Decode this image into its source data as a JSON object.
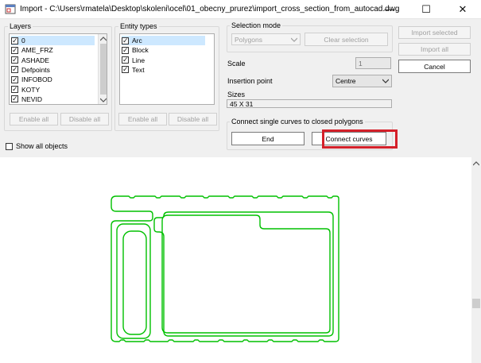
{
  "window": {
    "title": "Import - C:\\Users\\rmatela\\Desktop\\skoleni\\ocel\\01_obecny_prurez\\import_cross_section_from_autocad.dwg",
    "minimize_glyph": "—",
    "maximize_glyph": "☐",
    "close_glyph": "✕"
  },
  "layers": {
    "label": "Layers",
    "items": [
      "0",
      "AME_FRZ",
      "ASHADE",
      "Defpoints",
      "INFOBOD",
      "KOTY",
      "NEVID"
    ],
    "selected_index": 0,
    "enable_all": "Enable all",
    "disable_all": "Disable all"
  },
  "entity_types": {
    "label": "Entity types",
    "items": [
      "Arc",
      "Block",
      "Line",
      "Text"
    ],
    "selected_index": 0,
    "enable_all": "Enable all",
    "disable_all": "Disable all"
  },
  "show_all_objects": "Show all objects",
  "selection_mode": {
    "label": "Selection mode",
    "value": "Polygons",
    "clear_selection": "Clear selection"
  },
  "scale": {
    "label": "Scale",
    "value": "1"
  },
  "insertion_point": {
    "label": "Insertion point",
    "value": "Centre"
  },
  "sizes": {
    "label": "Sizes",
    "value": "45 X 31"
  },
  "connect": {
    "label": "Connect single curves to closed polygons",
    "end": "End",
    "connect_curves": "Connect curves"
  },
  "actions": {
    "import_selected": "Import selected",
    "import_all": "Import all",
    "cancel": "Cancel"
  },
  "colors": {
    "curve": "#00c000",
    "highlight": "#d4202a",
    "selection": "#cde8ff"
  }
}
